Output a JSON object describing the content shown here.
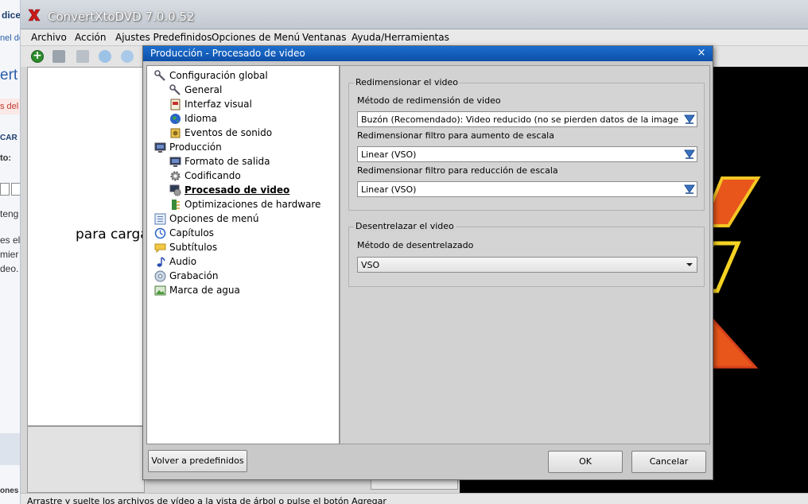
{
  "background_page": {
    "fragments": [
      "dice",
      "nel del",
      "ert",
      "s del l",
      "CAR I",
      "to:",
      "teng",
      "es el",
      "mier",
      "deo.",
      "ones"
    ]
  },
  "app": {
    "title": "ConvertXtoDVD 7.0.0.52",
    "accent_color": "#cc1a1a",
    "menu": [
      "Archivo",
      "Acción",
      "Ajustes Predefinidos",
      "Opciones de Menú",
      "Ventanas",
      "Ayuda/Herramientas"
    ],
    "drop_hint": "para carga",
    "status": "Arrastre y suelte los archivos de vídeo a la vista de árbol o pulse el botón Agregar"
  },
  "toolbar": {
    "icons": [
      "add-icon",
      "save-icon",
      "close-project-icon",
      "move-down-icon",
      "move-up-icon"
    ]
  },
  "dialog": {
    "title": "Producción - Procesado de video",
    "close_glyph": "×",
    "title_color": "#0d4fa8",
    "tree": [
      {
        "label": "Configuración global",
        "level": 0,
        "icon": "wrench-icon"
      },
      {
        "label": "General",
        "level": 1,
        "icon": "wrench-icon"
      },
      {
        "label": "Interfaz visual",
        "level": 1,
        "icon": "interface-icon"
      },
      {
        "label": "Idioma",
        "level": 1,
        "icon": "globe-icon"
      },
      {
        "label": "Eventos de sonido",
        "level": 1,
        "icon": "sound-events-icon"
      },
      {
        "label": "Producción",
        "level": 0,
        "icon": "monitor-icon"
      },
      {
        "label": "Formato de salida",
        "level": 1,
        "icon": "monitor-icon"
      },
      {
        "label": "Codificando",
        "level": 1,
        "icon": "gear-icon"
      },
      {
        "label": "Procesado de video",
        "level": 1,
        "icon": "video-processing-icon",
        "selected": true
      },
      {
        "label": "Optimizaciones de hardware",
        "level": 1,
        "icon": "hardware-icon"
      },
      {
        "label": "Opciones de menú",
        "level": 0,
        "icon": "menu-icon"
      },
      {
        "label": "Capítulos",
        "level": 0,
        "icon": "clock-icon"
      },
      {
        "label": "Subtítulos",
        "level": 0,
        "icon": "subtitles-icon"
      },
      {
        "label": "Audio",
        "level": 0,
        "icon": "music-note-icon"
      },
      {
        "label": "Grabación",
        "level": 0,
        "icon": "disc-icon"
      },
      {
        "label": "Marca de agua",
        "level": 0,
        "icon": "watermark-icon"
      }
    ],
    "resize_group": {
      "label": "Redimensionar el video",
      "method_label": "Método de redimensión de video",
      "method_value": "Buzón (Recomendado): Video reducido (no se pierden datos de la imagen, se podría",
      "upscale_label": "Redimensionar filtro para aumento de escala",
      "upscale_value": "Linear (VSO)",
      "downscale_label": "Redimensionar filtro para reducción de escala",
      "downscale_value": "Linear (VSO)"
    },
    "deinterlace_group": {
      "label": "Desentrelazar el video",
      "method_label": "Método de desentrelazado",
      "method_value": "VSO"
    },
    "buttons": {
      "defaults": "Volver a predefinidos",
      "ok": "OK",
      "cancel": "Cancelar"
    }
  }
}
